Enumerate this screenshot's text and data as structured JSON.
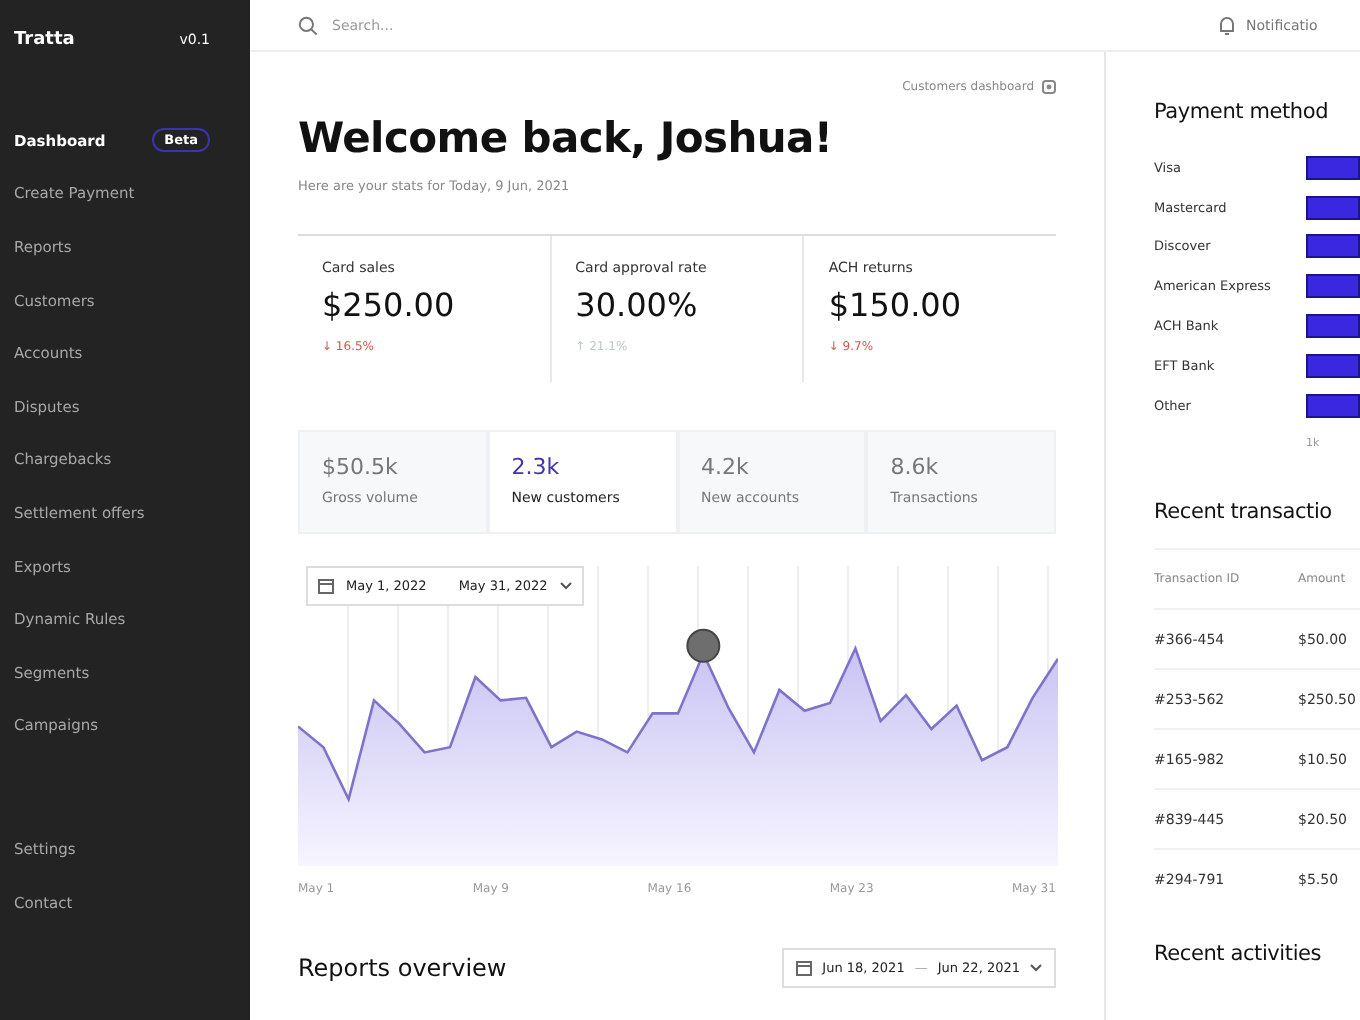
{
  "sidebar": {
    "brand": "Tratta",
    "version": "v0.1",
    "items": [
      {
        "label": "Dashboard",
        "selected": true,
        "badge": "Beta"
      },
      {
        "label": "Create Payment",
        "selected": false
      },
      {
        "label": "Reports",
        "selected": false
      },
      {
        "label": "Customers",
        "selected": false
      },
      {
        "label": "Accounts",
        "selected": false
      },
      {
        "label": "Disputes",
        "selected": false
      },
      {
        "label": "Chargebacks",
        "selected": false
      },
      {
        "label": "Settlement offers",
        "selected": false
      },
      {
        "label": "Exports",
        "selected": false
      },
      {
        "label": "Dynamic Rules",
        "selected": false
      },
      {
        "label": "Segments",
        "selected": false
      },
      {
        "label": "Campaigns",
        "selected": false
      }
    ],
    "bottom_items": [
      {
        "label": "Settings",
        "selected": false
      },
      {
        "label": "Contact",
        "selected": false
      }
    ]
  },
  "topbar": {
    "search": {
      "placeholder": "Search..."
    },
    "notifications": "Notificatio"
  },
  "main": {
    "customers_link": "Customers dashboard",
    "title": "Welcome back, Joshua!",
    "subtitle": "Here are your stats for Today, 9 Jun, 2021",
    "stats": [
      {
        "label": "Card sales",
        "value": "$250.00",
        "delta": "↓ 16.5%",
        "color": "#d9534f"
      },
      {
        "label": "Card approval rate",
        "value": "30.00%",
        "delta": "↑ 21.1%",
        "color": "#b8c9c0"
      },
      {
        "label": "ACH returns",
        "value": "$150.00",
        "delta": "↓ 9.7%",
        "color": "#d9534f"
      }
    ],
    "metric_tabs": [
      {
        "value": "$50.5k",
        "label": "Gross volume",
        "selected": false
      },
      {
        "value": "2.3k",
        "label": "New customers",
        "selected": true
      },
      {
        "value": "4.2k",
        "label": "New accounts",
        "selected": false
      },
      {
        "value": "8.6k",
        "label": "Transactions",
        "selected": false
      }
    ],
    "chart": {
      "date_from": "May 1, 2022",
      "date_to": "May 31, 2022",
      "x_labels": [
        "May 1",
        "May 9",
        "May 16",
        "May 23",
        "May 31"
      ]
    },
    "reports_overview": {
      "title": "Reports overview",
      "date_from": "Jun 18, 2021",
      "separator": "—",
      "date_to": "Jun 22, 2021"
    }
  },
  "right_panel": {
    "payment_methods": {
      "title": "Payment method",
      "methods": [
        "Visa",
        "Mastercard",
        "Discover",
        "American Express",
        "ACH Bank",
        "EFT Bank",
        "Other"
      ],
      "tick": "1k"
    },
    "recent_transactions": {
      "title": "Recent transactio",
      "columns": [
        "Transaction ID",
        "Amount"
      ],
      "rows": [
        [
          "#366-454",
          "$50.00"
        ],
        [
          "#253-562",
          "$250.50"
        ],
        [
          "#165-982",
          "$10.50"
        ],
        [
          "#839-445",
          "$20.50"
        ],
        [
          "#294-791",
          "$5.50"
        ]
      ]
    },
    "recent_activities": {
      "title": "Recent activities"
    }
  }
}
